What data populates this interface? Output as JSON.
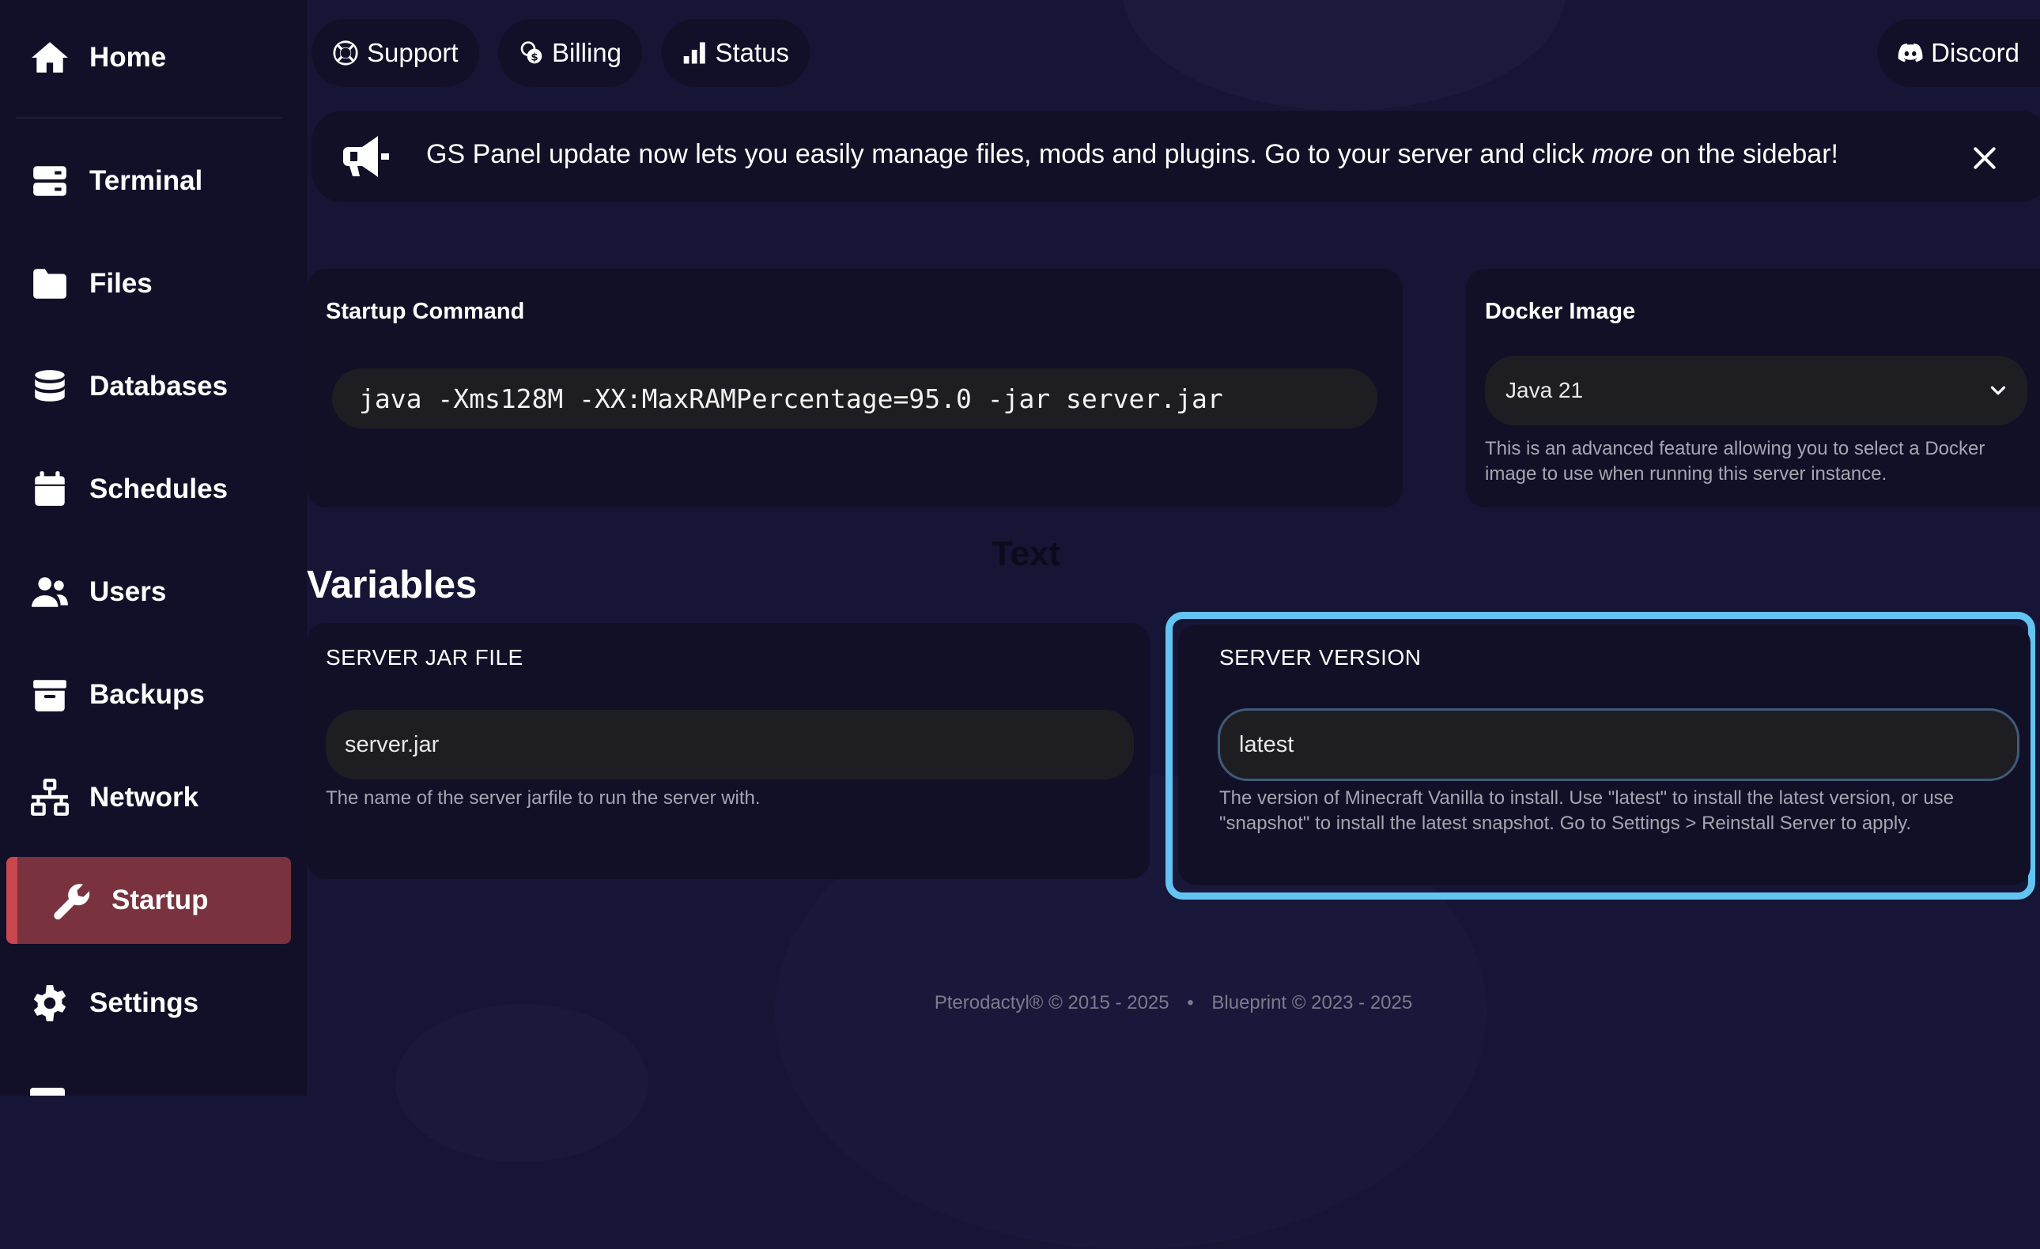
{
  "sidebar": {
    "items": [
      {
        "label": "Home",
        "icon": "home-icon"
      },
      {
        "label": "Terminal",
        "icon": "terminal-icon"
      },
      {
        "label": "Files",
        "icon": "folder-icon"
      },
      {
        "label": "Databases",
        "icon": "database-icon"
      },
      {
        "label": "Schedules",
        "icon": "calendar-icon"
      },
      {
        "label": "Users",
        "icon": "users-icon"
      },
      {
        "label": "Backups",
        "icon": "archive-icon"
      },
      {
        "label": "Network",
        "icon": "network-icon"
      },
      {
        "label": "Startup",
        "icon": "wrench-icon",
        "active": true
      },
      {
        "label": "Settings",
        "icon": "gear-icon"
      }
    ]
  },
  "topbar": {
    "support": "Support",
    "billing": "Billing",
    "status": "Status",
    "discord": "Discord"
  },
  "announcement": {
    "text_before": "GS Panel update now lets you easily manage files, mods and plugins. Go to your server and click ",
    "text_emph": "more",
    "text_after": " on the sidebar!"
  },
  "startup": {
    "title": "Startup Command",
    "command": "java -Xms128M -XX:MaxRAMPercentage=95.0 -jar server.jar"
  },
  "docker": {
    "title": "Docker Image",
    "selected": "Java 21",
    "help": "This is an advanced feature allowing you to select a Docker image to use when running this server instance."
  },
  "overlay_text": "Text",
  "variables": {
    "title": "Variables",
    "items": [
      {
        "name": "SERVER JAR FILE",
        "value": "server.jar",
        "help": "The name of the server jarfile to run the server with."
      },
      {
        "name": "SERVER VERSION",
        "value": "latest",
        "help": "The version of Minecraft Vanilla to install. Use \"latest\" to install the latest version, or use \"snapshot\" to install the latest snapshot. Go to Settings > Reinstall Server to apply."
      }
    ]
  },
  "footer": {
    "pterodactyl": "Pterodactyl® © 2015 - 2025",
    "separator": "•",
    "blueprint": "Blueprint © 2023 - 2025"
  },
  "colors": {
    "background": "#161535",
    "sidebar": "#121028",
    "active_item": "#7a323f",
    "active_accent": "#c9474f",
    "card": "#121027",
    "input": "#1e1e22",
    "highlight": "#63c4f2"
  }
}
